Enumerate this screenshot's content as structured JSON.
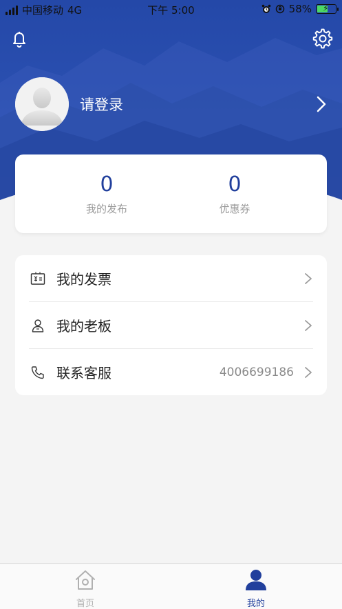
{
  "status_bar": {
    "carrier": "中国移动",
    "network": "4G",
    "time": "下午 5:00",
    "battery": "58%",
    "battery_level": 0.58,
    "icons": [
      "signal-icon",
      "alarm-icon",
      "orientation-lock-icon",
      "battery-icon"
    ]
  },
  "header": {
    "bell_icon": "bell-icon",
    "settings_icon": "gear-icon",
    "login_label": "请登录",
    "colors": {
      "primary": "#213f9c",
      "header_bg": "#2a4fb0"
    }
  },
  "stats": {
    "publish": {
      "value": "0",
      "label": "我的发布"
    },
    "coupon": {
      "value": "0",
      "label": "优惠券"
    }
  },
  "menu": {
    "invoice": {
      "label": "我的发票",
      "icon": "invoice-icon"
    },
    "boss": {
      "label": "我的老板",
      "icon": "person-icon"
    },
    "service": {
      "label": "联系客服",
      "value": "4006699186",
      "icon": "phone-icon"
    }
  },
  "tab_bar": {
    "home": {
      "label": "首页",
      "icon": "home-icon",
      "active": false
    },
    "mine": {
      "label": "我的",
      "icon": "person-filled-icon",
      "active": true
    }
  }
}
